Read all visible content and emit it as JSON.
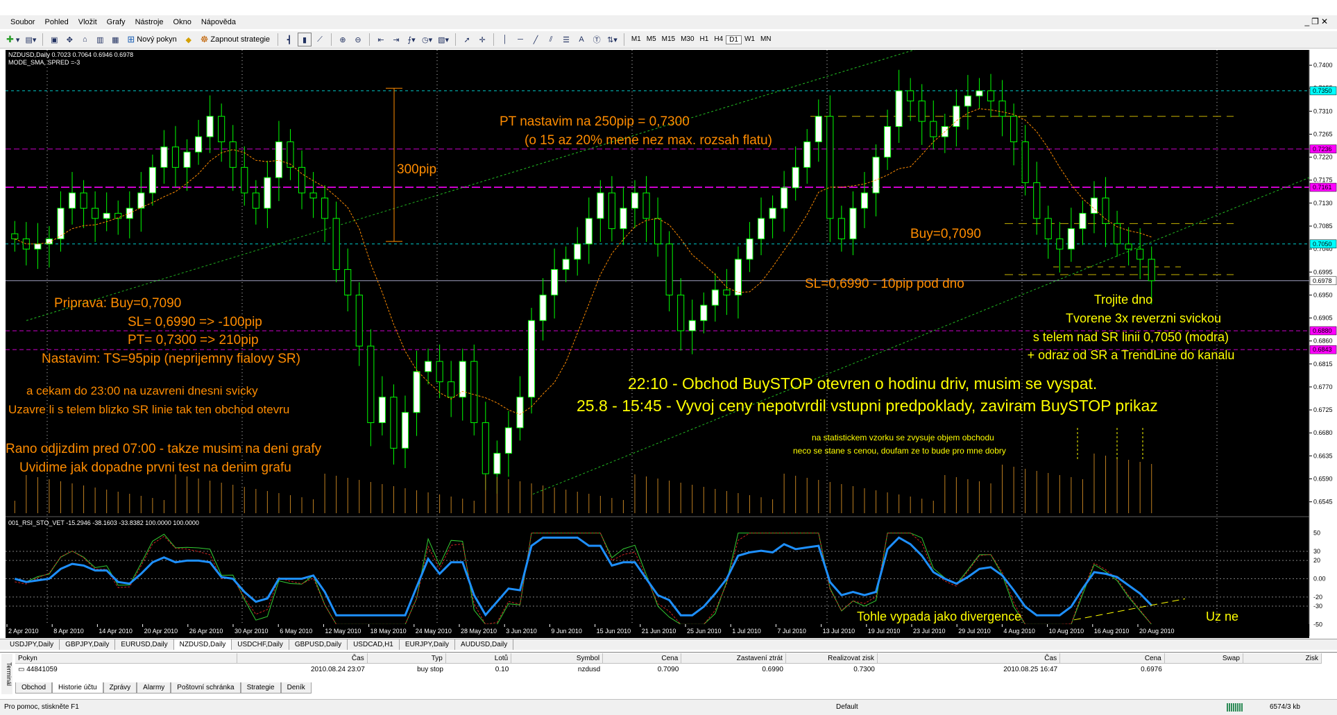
{
  "menu": [
    "Soubor",
    "Pohled",
    "Vložit",
    "Grafy",
    "Nástroje",
    "Okno",
    "Nápověda"
  ],
  "toolbar": {
    "new_order": "Nový pokyn",
    "start_strategy": "Zapnout strategie",
    "timeframes": [
      "M1",
      "M5",
      "M15",
      "M30",
      "H1",
      "H4",
      "D1",
      "W1",
      "MN"
    ],
    "active_timeframe": "D1",
    "text_tool": "A"
  },
  "chart": {
    "info_line1": "NZDUSD,Daily 0.7023 0.7064 0.6946 0.6978",
    "info_line2": "MODE_SMA, SPRED =-3",
    "indicator_line": "001_RSI_STO_VET -15.2946 -38.1603 -33.8382 100.0000 100.0000",
    "price_labels": [
      "0.7400",
      "0.7355",
      "0.7310",
      "0.7265",
      "0.7220",
      "0.7175",
      "0.7130",
      "0.7085",
      "0.7040",
      "0.6995",
      "0.6950",
      "0.6905",
      "0.6860",
      "0.6815",
      "0.6770",
      "0.6725",
      "0.6680",
      "0.6635",
      "0.6590",
      "0.6545"
    ],
    "highlight_labels": [
      {
        "text": "0.7350",
        "color": "#00ffff"
      },
      {
        "text": "0.7236",
        "color": "#ff00ff"
      },
      {
        "text": "0.7161",
        "color": "#ff00ff"
      },
      {
        "text": "0.7050",
        "color": "#00ffff"
      },
      {
        "text": "0.6978",
        "color": "#ffffff"
      },
      {
        "text": "0.6880",
        "color": "#ff00ff"
      },
      {
        "text": "0.6843",
        "color": "#ff00ff"
      }
    ],
    "indicator_labels": [
      "50",
      "30",
      "20",
      "0.00",
      "-20",
      "-30",
      "-50"
    ],
    "date_labels": [
      "2 Apr 2010",
      "8 Apr 2010",
      "14 Apr 2010",
      "20 Apr 2010",
      "26 Apr 2010",
      "30 Apr 2010",
      "6 May 2010",
      "12 May 2010",
      "18 May 2010",
      "24 May 2010",
      "28 May 2010",
      "3 Jun 2010",
      "9 Jun 2010",
      "15 Jun 2010",
      "21 Jun 2010",
      "25 Jun 2010",
      "1 Jul 2010",
      "7 Jul 2010",
      "13 Jul 2010",
      "19 Jul 2010",
      "23 Jul 2010",
      "29 Jul 2010",
      "4 Aug 2010",
      "10 Aug 2010",
      "16 Aug 2010",
      "20 Aug 2010"
    ],
    "annotations": {
      "pt_line1": "PT nastavim na 250pip = 0,7300",
      "pt_line2": "(o 15 az 20% mene nez max. rozsah flatu)",
      "pip300": "300pip",
      "buy": "Buy=0,7090",
      "sl": "SL=0,6990 - 10pip pod dno",
      "priprava": "Priprava:  Buy=0,7090",
      "sl2": "SL= 0,6990  => -100pip",
      "pt2": "PT= 0,7300  => 210pip",
      "nastavim": "Nastavim:    TS=95pip (neprijemny fialovy SR)",
      "cekam1": "a cekam do 23:00 na uzavreni dnesni svicky",
      "cekam2": "Uzavre li s telem blizko SR linie tak ten obchod otevru",
      "rano1": "Rano odjizdim pred 07:00 - takze musim na deni grafy",
      "rano2": "Uvidime jak dopadne prvni test na denim grafu",
      "trojite1": "Trojite dno",
      "trojite2": "Tvorene 3x reverzni svickou",
      "trojite3": "s telem nad SR linii 0,7050 (modra)",
      "trojite4": "+ odraz od SR a TrendLine do kanalu",
      "obchod1": "22:10 - Obchod BuySTOP otevren o hodinu driv, musim se vyspat.",
      "obchod2": "25.8 - 15:45 - Vyvoj ceny nepotvrdil vstupni predpoklady, zaviram BuySTOP prikaz",
      "objem1": "na statistickem vzorku se zvysuje objem obchodu",
      "objem2": "neco se stane s cenou, doufam ze to bude pro mne dobry",
      "divergence": "Tohle vypada jako divergence",
      "uzne": "Uz ne"
    },
    "colors": {
      "background": "#000000",
      "bull_candle": "#ffffff",
      "wick": "#00ff00",
      "annotation": "#ff8c00",
      "annotation_yellow": "#ffff00",
      "sr_magenta": "#cc00cc",
      "sr_cyan": "#00cccc",
      "channel": "#22bb22",
      "rsi_main": "#1e90ff"
    }
  },
  "symbol_tabs": [
    "USDJPY,Daily",
    "GBPJPY,Daily",
    "EURUSD,Daily",
    "NZDUSD,Daily",
    "USDCHF,Daily",
    "GBPUSD,Daily",
    "USDCAD,H1",
    "EURJPY,Daily",
    "AUDUSD,Daily"
  ],
  "active_symbol_tab": "NZDUSD,Daily",
  "terminal": {
    "headers": [
      "Pokyn",
      "Čas",
      "Typ",
      "Lotů",
      "Symbol",
      "Cena",
      "Zastavení ztrát",
      "Realizovat zisk",
      "Čas",
      "Cena",
      "Swap",
      "Zisk"
    ],
    "row": [
      "44841059",
      "2010.08.24 23:07",
      "buy stop",
      "0.10",
      "nzdusd",
      "0.7090",
      "0.6990",
      "0.7300",
      "2010.08.25 16:47",
      "0.6976",
      "",
      ""
    ],
    "tabs": [
      "Obchod",
      "Historie účtu",
      "Zprávy",
      "Alarmy",
      "Poštovní schránka",
      "Strategie",
      "Deník"
    ],
    "active_tab": "Historie účtu",
    "side_label": "Terminál"
  },
  "status": {
    "help": "Pro pomoc, stiskněte F1",
    "profile": "Default",
    "traffic": "6574/3 kb"
  }
}
